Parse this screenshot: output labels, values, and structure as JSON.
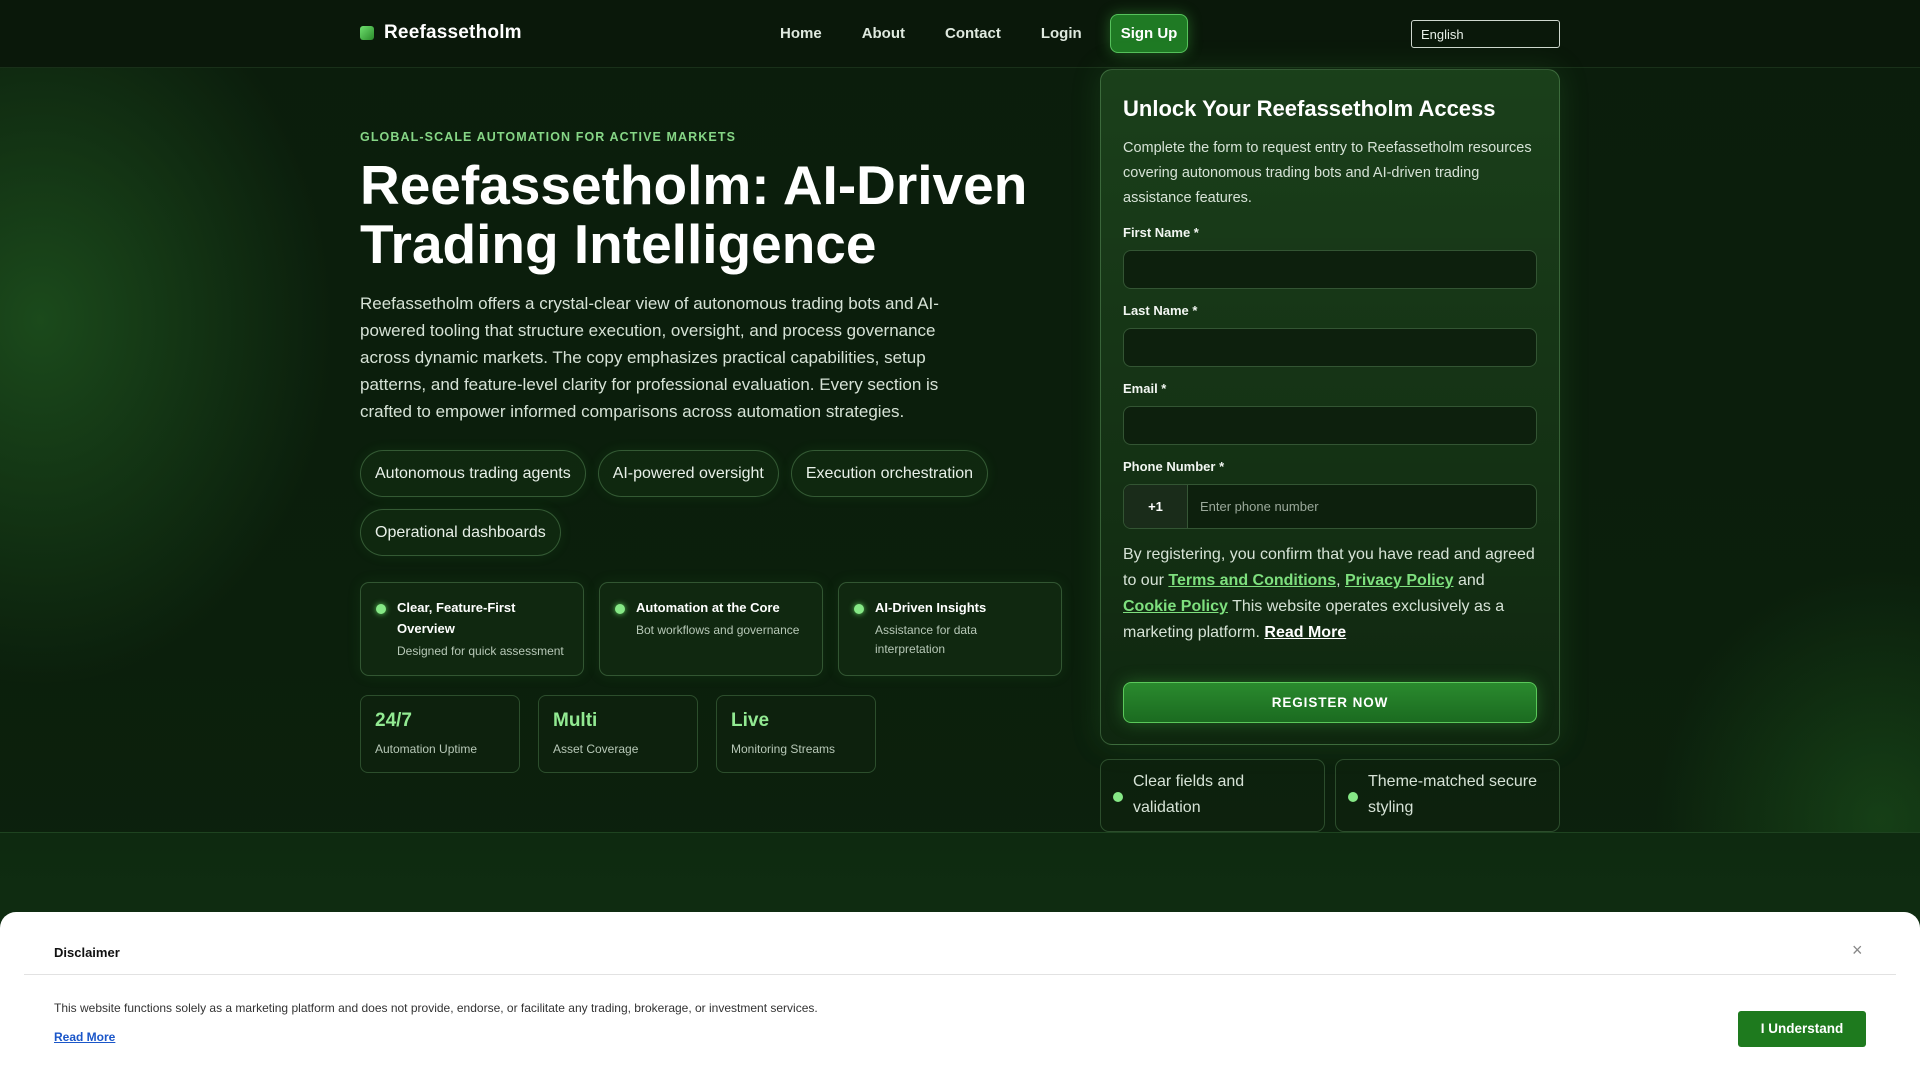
{
  "header": {
    "brand": "Reefassetholm",
    "nav": [
      "Home",
      "About",
      "Contact",
      "Login"
    ],
    "signup": "Sign Up",
    "language": "English"
  },
  "hero": {
    "eyebrow": "GLOBAL-SCALE AUTOMATION FOR ACTIVE MARKETS",
    "title": "Reefassetholm: AI-Driven Trading Intelligence",
    "lead": "Reefassetholm offers a crystal-clear view of autonomous trading bots and AI-powered tooling that structure execution, oversight, and process governance across dynamic markets. The copy emphasizes practical capabilities, setup patterns, and feature-level clarity for professional evaluation. Every section is crafted to empower informed comparisons across automation strategies.",
    "chips": [
      "Autonomous trading agents",
      "AI-powered oversight",
      "Execution orchestration",
      "Operational dashboards"
    ],
    "features": [
      {
        "title": "Clear, Feature-First Overview",
        "desc": "Designed for quick assessment"
      },
      {
        "title": "Automation at the Core",
        "desc": "Bot workflows and governance"
      },
      {
        "title": "AI-Driven Insights",
        "desc": "Assistance for data interpretation"
      }
    ],
    "stats": [
      {
        "value": "24/7",
        "label": "Automation Uptime"
      },
      {
        "value": "Multi",
        "label": "Asset Coverage"
      },
      {
        "value": "Live",
        "label": "Monitoring Streams"
      }
    ]
  },
  "form": {
    "title": "Unlock Your Reefassetholm Access",
    "description": "Complete the form to request entry to Reefassetholm resources covering autonomous trading bots and AI-driven trading assistance features.",
    "first_name_label": "First Name *",
    "last_name_label": "Last Name *",
    "email_label": "Email *",
    "phone_label": "Phone Number *",
    "country_code": "+1",
    "phone_placeholder": "Enter phone number",
    "consent_prefix": "By registering, you confirm that you have read and agreed to our",
    "terms": "Terms and Conditions",
    "privacy": "Privacy Policy",
    "and": "and",
    "cookie": "Cookie Policy",
    "consent_suffix": "This website operates exclusively as a marketing platform.",
    "read_more": "Read More",
    "register": "REGISTER NOW"
  },
  "mini_notes": [
    "Clear fields and validation",
    "Theme-matched secure styling"
  ],
  "disclaimer": {
    "title": "Disclaimer",
    "close": "×",
    "body": "This website functions solely as a marketing platform and does not provide, endorse, or facilitate any trading, brokerage, or investment services.",
    "read_more": "Read More",
    "button": "I Understand"
  }
}
